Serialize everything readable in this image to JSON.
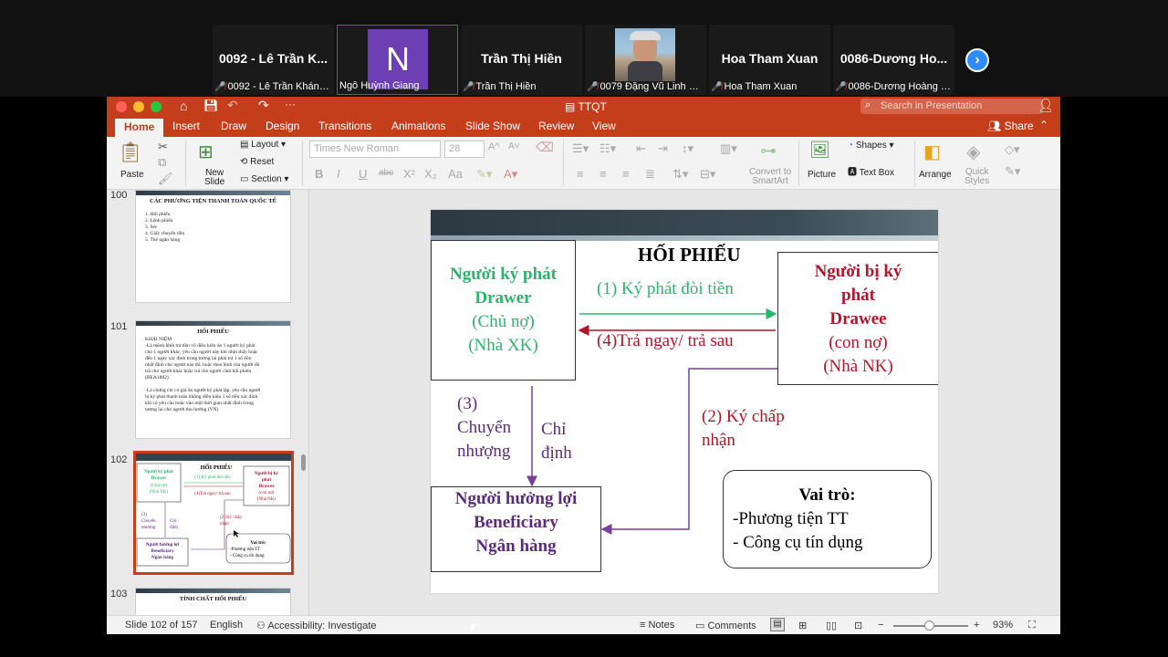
{
  "participants": [
    {
      "name": "0092 - Lê Trần K...",
      "caption": "0092 - Lê Trần Khánh ...",
      "type": "name"
    },
    {
      "name": "N",
      "caption": "Ngô Huỳnh Giang",
      "type": "avatar",
      "active": true
    },
    {
      "name": "Trần Thị Hiền",
      "caption": "Trần Thị Hiền",
      "type": "name"
    },
    {
      "name": "",
      "caption": "0079 Đặng Vũ Linh QT...",
      "type": "photo"
    },
    {
      "name": "Hoa Tham Xuan",
      "caption": "Hoa Tham Xuan",
      "type": "name"
    },
    {
      "name": "0086-Dương Ho...",
      "caption": "0086-Dương Hoàng M...",
      "type": "name"
    }
  ],
  "app": {
    "doc_title": "TTQT",
    "search_placeholder": "Search in Presentation",
    "share_label": "Share",
    "tabs": [
      "Home",
      "Insert",
      "Draw",
      "Design",
      "Transitions",
      "Animations",
      "Slide Show",
      "Review",
      "View"
    ]
  },
  "ribbon": {
    "paste": "Paste",
    "new_slide_1": "New",
    "new_slide_2": "Slide",
    "layout": "Layout",
    "reset": "Reset",
    "section": "Section",
    "font_name": "Times New Roman",
    "font_size": "28",
    "convert_1": "Convert to",
    "convert_2": "SmartArt",
    "picture": "Picture",
    "shapes": "Shapes",
    "text_box": "Text Box",
    "arrange": "Arrange",
    "quick_1": "Quick",
    "quick_2": "Styles"
  },
  "thumbnails": [
    {
      "number": "100",
      "title": "CÁC PHƯƠNG TIỆN THANH TOÁN QUỐC TẾ",
      "lines": [
        "1.   Hối phiếu",
        "2.   Lệnh phiếu",
        "3.   Séc",
        "4.   Giấy chuyển tiền",
        "5.   Thẻ ngân hàng"
      ]
    },
    {
      "number": "101",
      "title": "HỐI PHIẾU",
      "lines": [
        "KHÁI NIỆM",
        "-Là mệnh lệnh trả tiền vô điều kiện do 1 người ký phát",
        "cho 1 người khác, yêu cầu người này khi nhìn thấy hoặc",
        "đến 1 ngày xác định trong tương lai phải trả 1 số tiền",
        "nhất định cho người nào đó, hoặc theo lệnh của người đó",
        "trả cho người khác hoặc trả cho người cầm hối phiếu",
        "(BEA1882)",
        "",
        "-Là chứng chỉ có giá do người ký phát lập, yêu cầu người",
        "bị ký phát thanh toán không điều kiện 1 số tiền xác định",
        "khi có yêu cầu hoặc vào một thời gian nhất định trong",
        "tương lai cho người thụ hưởng (VN)"
      ]
    },
    {
      "number": "102",
      "title": "HỐI PHIẾU"
    },
    {
      "number": "103",
      "title": "TÍNH CHẤT HỐI PHIẾU"
    }
  ],
  "slide": {
    "title": "HỐI PHIẾU",
    "drawer": {
      "l1": "Người ký phát",
      "l2": "Drawer",
      "l3": "(Chủ nợ)",
      "l4": "(Nhà XK)"
    },
    "drawee": {
      "l1": "Người bị ký",
      "l2": "phát",
      "l3": "Drawee",
      "l4": "(con nợ)",
      "l5": "(Nhà NK)"
    },
    "beneficiary": {
      "l1": "Người hưởng lợi",
      "l2": "Beneficiary",
      "l3": "Ngân hàng"
    },
    "arrow1": "(1) Ký phát đòi tiền",
    "arrow4": "(4)Trả ngay/ trả sau",
    "step3": {
      "l1": "(3)",
      "l2": "Chuyển",
      "l3": "nhượng"
    },
    "chi_dinh": {
      "l1": "Chỉ",
      "l2": "định"
    },
    "step2": {
      "l1": "(2) Ký chấp",
      "l2": "nhận"
    },
    "role": {
      "title": "Vai trò:",
      "l1": "-Phương tiện TT",
      "l2": "- Công cụ tín dụng"
    }
  },
  "mini": {
    "drawer": [
      "Người ký phát",
      "Drawer",
      "(Chủ nợ)",
      "(Nhà XK)"
    ],
    "drawee": [
      "Người bị ký",
      "phát",
      "Drawee",
      "(con nợ)",
      "(Nhà NK)"
    ],
    "a1": "(1) Ký phát đòi tiền",
    "a4": "(4)Trả ngay/ trả sau",
    "s3": [
      "(3)",
      "Chuyển",
      "nhượng"
    ],
    "cd": [
      "Chỉ",
      "định"
    ],
    "s2": [
      "(2) Ký chấp",
      "nhận"
    ],
    "ben": [
      "Người hưởng lợi",
      "Beneficiary",
      "Ngân hàng"
    ],
    "role": [
      "Vai trò:",
      "-Phương tiện TT",
      "- Công cụ tín dụng"
    ]
  },
  "status": {
    "slide_pos": "Slide 102 of 157",
    "language": "English",
    "accessibility": "Accessibility: Investigate",
    "notes": "Notes",
    "comments": "Comments",
    "zoom": "93%"
  }
}
